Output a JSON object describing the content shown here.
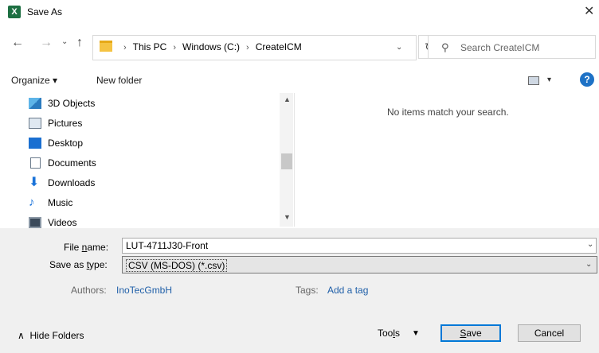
{
  "window": {
    "title": "Save As",
    "app_icon": "excel-icon",
    "close_glyph": "✕"
  },
  "nav": {
    "back_glyph": "←",
    "forward_glyph": "→",
    "recent_glyph": "⌄",
    "up_glyph": "↑",
    "breadcrumbs": [
      "This PC",
      "Windows (C:)",
      "CreateICM"
    ],
    "breadcrumb_sep": "›",
    "refresh_glyph": "↻",
    "search_placeholder": "Search CreateICM"
  },
  "toolbar": {
    "organize": "Organize ▾",
    "new_folder": "New folder",
    "help": "?"
  },
  "sidebar": {
    "items": [
      {
        "label": "3D Objects",
        "icon": "cube-icon"
      },
      {
        "label": "Pictures",
        "icon": "pictures-icon"
      },
      {
        "label": "Desktop",
        "icon": "desktop-icon"
      },
      {
        "label": "Documents",
        "icon": "documents-icon"
      },
      {
        "label": "Downloads",
        "icon": "downloads-icon"
      },
      {
        "label": "Music",
        "icon": "music-icon"
      },
      {
        "label": "Videos",
        "icon": "videos-icon"
      }
    ]
  },
  "content": {
    "empty_message": "No items match your search."
  },
  "form": {
    "file_name_label_pre": "File ",
    "file_name_label_u": "n",
    "file_name_label_post": "ame:",
    "file_name_value": "LUT-4711J30-Front",
    "save_type_label_pre": "Save as ",
    "save_type_label_u": "t",
    "save_type_label_post": "ype:",
    "save_type_value": "CSV (MS-DOS) (*.csv)",
    "authors_label": "Authors:",
    "authors_value": "InoTecGmbH",
    "tags_label": "Tags:",
    "tags_value": "Add a tag"
  },
  "footer": {
    "hide_folders": "Hide Folders",
    "tools_pre": "Too",
    "tools_u": "l",
    "tools_post": "s",
    "save_u": "S",
    "save_post": "ave",
    "cancel": "Cancel"
  },
  "colors": {
    "accent": "#0078d7",
    "link": "#1f5fa8",
    "panel": "#f0f0f0",
    "help": "#1e72c6"
  }
}
